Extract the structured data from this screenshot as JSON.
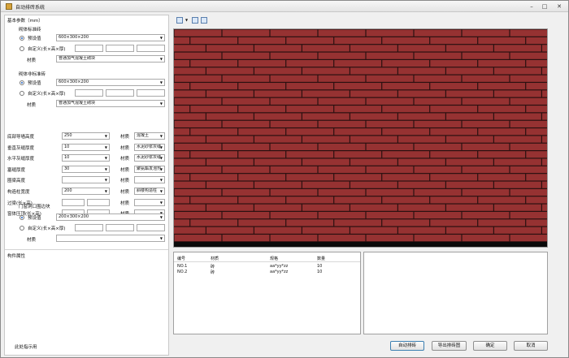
{
  "window": {
    "title": "自动排砖系统"
  },
  "left": {
    "section_title": "基本参数（mm）",
    "group1": {
      "title": "砌体标准砖",
      "preset_label": "预设值",
      "preset_value": "600×300×200",
      "custom_label": "自定义(长×高×厚)",
      "material_label": "材质",
      "material_value": "普通加气混凝土砌块"
    },
    "group2": {
      "title": "砌体非标准砖",
      "preset_label": "预设值",
      "preset_value": "600×300×200",
      "custom_label": "自定义(长×高×厚)",
      "material_label": "材质",
      "material_value": "普通加气混凝土砌块"
    },
    "params": [
      {
        "label": "底部导墙高度",
        "value": "250",
        "mat_label": "材质",
        "mat_value": "混凝土"
      },
      {
        "label": "垂直灰缝厚度",
        "value": "10",
        "mat_label": "材质",
        "mat_value": "水泥砂浆灰缝"
      },
      {
        "label": "水平灰缝厚度",
        "value": "10",
        "mat_label": "材质",
        "mat_value": "水泥砂浆灰缝"
      },
      {
        "label": "塞缝厚度",
        "value": "30",
        "mat_label": "材质",
        "mat_value": "聚氨酯发泡剂"
      },
      {
        "label": "圈梁高度",
        "value": "",
        "mat_label": "材质",
        "mat_value": ""
      },
      {
        "label": "构造柱宽度",
        "value": "200",
        "mat_label": "材质",
        "mat_value": "斜楼构造柱"
      },
      {
        "label": "过梁(长×高)",
        "value": "",
        "mat_label": "材质",
        "mat_value": ""
      },
      {
        "label": "窗体压顶(长×高)",
        "value": "",
        "mat_label": "材质",
        "mat_value": ""
      }
    ],
    "group3": {
      "title": "门窗洞口围边块",
      "preset_label": "预设值",
      "preset_value": "200×300×200",
      "custom_label": "自定义(长×高×厚)",
      "material_label": "材质",
      "material_value": ""
    },
    "props_title": "构件属性",
    "status_text": "此处指示用"
  },
  "table": {
    "headers": [
      "编号",
      "材质",
      "规格",
      "数量"
    ],
    "rows": [
      [
        "NO.1",
        "砖",
        "aa*yy*zz",
        "10"
      ],
      [
        "NO.2",
        "砖",
        "aa*yy*zz",
        "10"
      ]
    ]
  },
  "buttons": {
    "auto_layout": "自动排砖",
    "export": "导出排砖图",
    "ok": "确定",
    "cancel": "取消"
  },
  "colors": {
    "brick": "#963232",
    "mortar": "#2a1010",
    "base_band": "#0a0a0a"
  }
}
